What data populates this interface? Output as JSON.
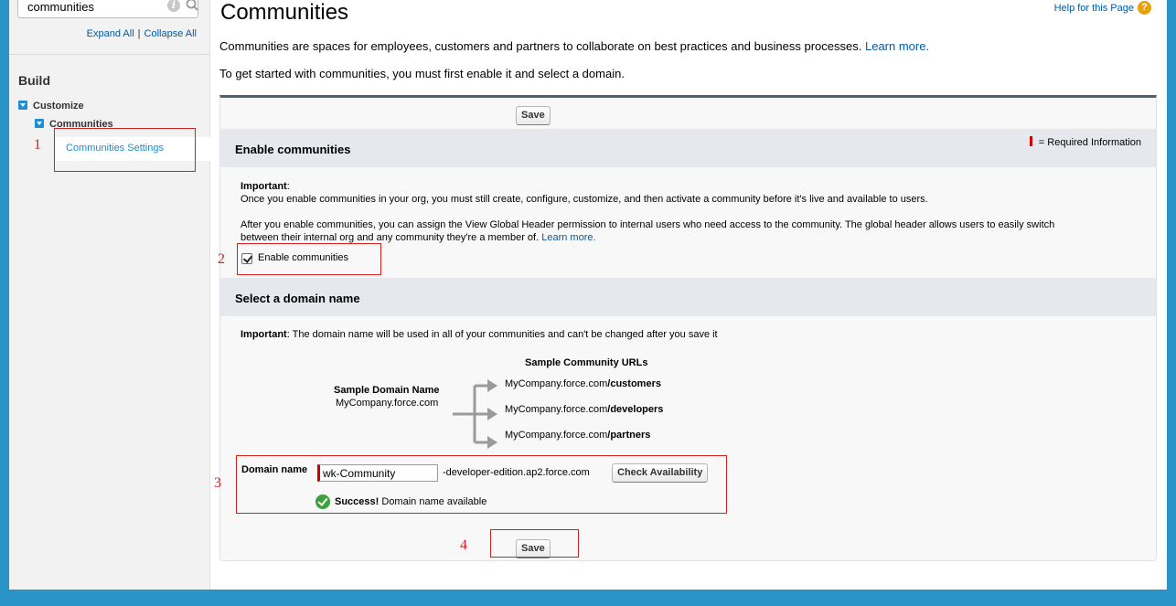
{
  "sidebar": {
    "search_value": "communities",
    "expand_all": "Expand All",
    "separator": "|",
    "collapse_all": "Collapse All",
    "section_title": "Build",
    "tree": {
      "customize": "Customize",
      "communities": "Communities",
      "communities_settings": "Communities Settings"
    }
  },
  "header": {
    "title": "Communities",
    "help_link": "Help for this Page",
    "help_icon_glyph": "?"
  },
  "intro": {
    "line1": "Communities are spaces for employees, customers and partners to collaborate on best practices and business processes.",
    "line1_link": "Learn more.",
    "line2": "To get started with communities, you must first enable it and select a domain."
  },
  "panel": {
    "save_label": "Save",
    "required_info": "= Required Information",
    "enable_section": {
      "heading": "Enable communities",
      "important_label": "Important",
      "important_colon": ":",
      "important_text": "Once you enable communities in your org, you must still create, configure, customize, and then activate a community before it's live and available to users.",
      "para2_line1": "After you enable communities, you can assign the View Global Header permission to internal users who need access to the community. The global header allows users to easily switch",
      "para2_line2": "between their internal org and any community they're a member of.",
      "learn_more": "Learn more.",
      "checkbox_label": "Enable communities",
      "checkbox_checked": true
    },
    "domain_section": {
      "heading": "Select a domain name",
      "important_label": "Important",
      "important_text": ": The domain name will be used in all of your communities and can't be changed after you save it",
      "sample_urls_title": "Sample Community URLs",
      "sample_domain_title": "Sample Domain Name",
      "sample_domain": "MyCompany.force.com",
      "sample_urls": [
        {
          "base": "MyCompany.force.com",
          "path": "/customers"
        },
        {
          "base": "MyCompany.force.com",
          "path": "/developers"
        },
        {
          "base": "MyCompany.force.com",
          "path": "/partners"
        }
      ],
      "domain_label": "Domain name",
      "domain_value": "wk-Community",
      "domain_suffix": "-developer-edition.ap2.force.com",
      "check_button": "Check Availability",
      "success_strong": "Success!",
      "success_text": "Domain name available"
    }
  },
  "annotations": [
    "1",
    "2",
    "3",
    "4"
  ],
  "colors": {
    "background": "#2a93c8",
    "link": "#015ba7",
    "annotation": "#d62020",
    "required": "#cc0000",
    "tree_toggle": "#1f8dd6"
  }
}
